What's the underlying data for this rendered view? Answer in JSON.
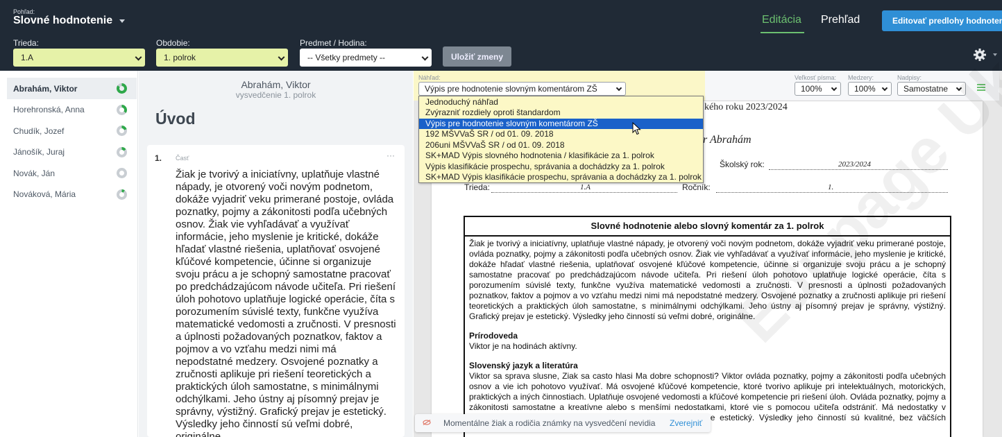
{
  "header": {
    "view_label": "Pohľad:",
    "view_title": "Slovné hodnotenie",
    "nav_edit": "Editácia",
    "nav_overview": "Prehľad",
    "edit_templates_button": "Editovať predlohy hodnotení",
    "accent_color": "#6cc070",
    "primary_color": "#2f8fd6"
  },
  "filters": {
    "class_label": "Trieda:",
    "class_value": "1.A",
    "period_label": "Obdobie:",
    "period_value": "1. polrok",
    "subject_label": "Predmet / Hodina:",
    "subject_value": "-- Všetky predmety --",
    "save_button": "Uložiť zmeny"
  },
  "students": [
    {
      "name": "Abrahám, Viktor",
      "active": true,
      "progress": 0.85
    },
    {
      "name": "Horehronská, Anna",
      "active": false,
      "progress": 0.35
    },
    {
      "name": "Chudík, Jozef",
      "active": false,
      "progress": 0.2
    },
    {
      "name": "Jánošík, Juraj",
      "active": false,
      "progress": 0.15
    },
    {
      "name": "Novák, Ján",
      "active": false,
      "progress": 0
    },
    {
      "name": "Nováková, Mária",
      "active": false,
      "progress": 0.1
    }
  ],
  "editor": {
    "student_name": "Abrahám, Viktor",
    "subtitle": "vysvedčenie 1. polrok",
    "section_title": "Úvod",
    "card_number": "1.",
    "card_part_label": "Časť",
    "card_menu": "···",
    "card_text": "Žiak je tvorivý a iniciatívny, uplatňuje vlastné nápady, je otvorený voči novým podnetom, dokáže vyjadriť veku primerané postoje, ovláda poznatky, pojmy a zákonitosti podľa učebných osnov. Žiak vie vyhľadávať a využívať informácie, jeho myslenie je kritické, dokáže hľadať vlastné riešenia, uplatňovať osvojené kľúčové kompetencie, účinne si organizuje svoju prácu a je schopný samostatne pracovať po predchádzajúcom návode učiteľa.  Pri riešení úloh pohotovo uplatňuje logické operácie, číta s porozumením súvislé texty, funkčne využíva matematické vedomosti a zručnosti. V presnosti a úplnosti požadovaných poznatkov, faktov a pojmov a vo vzťahu medzi nimi má nepodstatné medzery. Osvojené poznatky a zručnosti aplikuje pri riešení teoretických a praktických úloh samostatne, s minimálnymi odchýlkami. Jeho ústny aj písomný prejav je správny, výstižný. Grafický prejav je  estetický. Výsledky jeho činností sú veľmi dobré, originálne."
  },
  "preview_toolbar": {
    "view_label": "Náhľad:",
    "view_value": "Výpis pre hodnotenie slovným komentárom ZŠ",
    "font_size_label": "Veľkosť písma:",
    "font_size_value": "100%",
    "spacing_label": "Medzery:",
    "spacing_value": "100%",
    "captions_label": "Nadpisy:",
    "captions_value": "Samostatne"
  },
  "dropdown_options": [
    {
      "label": "Jednoduchý náhľad",
      "selected": false
    },
    {
      "label": "Zvýrazniť rozdiely oproti štandardom",
      "selected": false
    },
    {
      "label": "Výpis pre hodnotenie slovným komentárom ZŠ",
      "selected": true
    },
    {
      "label": "192 MŠVVaŠ SR / od 01. 09. 2018",
      "selected": false
    },
    {
      "label": "206uni MŠVVaŠ SR / od 01. 09. 2018",
      "selected": false
    },
    {
      "label": "SK+MAD Výpis slovného hodnotenia / klasifikácie za 1. polrok",
      "selected": false
    },
    {
      "label": "Výpis klasifikácie prospechu, správania a dochádzky za 1. polrok",
      "selected": false
    },
    {
      "label": "SK+MAD Výpis klasifikácie prospechu, správania a dochádzky za 1. polrok",
      "selected": false
    }
  ],
  "document": {
    "school_year_heading": "kého roku 2023/2024",
    "student_name_partial": "r Abrahám",
    "school_year_label": "Školský rok:",
    "school_year_value": "2023/2024",
    "class_label": "Trieda:",
    "class_value": "1.A",
    "grade_label": "Ročník:",
    "grade_value": "1.",
    "eval_title": "Slovné hodnotenie alebo slovný komentár za 1. polrok",
    "eval_intro": "Žiak je tvorivý a iniciatívny, uplatňuje vlastné nápady, je otvorený voči novým podnetom, dokáže vyjadriť veku primerané postoje, ovláda poznatky, pojmy a zákonitosti podľa učebných osnov. Žiak vie vyhľadávať a využívať informácie, jeho myslenie je kritické, dokáže hľadať vlastné riešenia, uplatňovať osvojené kľúčové kompetencie, účinne si organizuje svoju prácu a je schopný samostatne pracovať po predchádzajúcom návode učiteľa. Pri riešení úloh pohotovo uplatňuje logické operácie, číta s porozumením súvislé texty, funkčne využíva matematické vedomosti a zručnosti. V presnosti a úplnosti požadovaných poznatkov, faktov a pojmov a vo vzťahu medzi nimi má nepodstatné medzery. Osvojené poznatky a zručnosti aplikuje pri riešení teoretických a praktických úloh samostatne, s minimálnymi odchýlkami. Jeho ústny aj písomný prejav je správny, výstižný. Grafický prejav je estetický. Výsledky jeho činností sú veľmi dobré, originálne.",
    "subject1_title": "Prírodoveda",
    "subject1_text": "Viktor je na hodinách aktívny.",
    "subject2_title": "Slovenský jazyk a literatúra",
    "subject2_text": "Viktor sa sprava slusne, Ziak sa casto hlasi Ma dobre schopnosti? Viktor ovláda poznatky, pojmy a zákonitosti podľa učebných osnov a  vie ich pohotovo využívať. Má osvojené kľúčové kompetencie, ktoré tvorivo aplikuje pri intelektuálnych, motorických, praktických a iných činnostiach. Uplatňuje osvojené vedomosti a kľúčové kompetencie pri riešení úloh. Ovláda poznatky, pojmy a zákonitosti samostatne a kreatívne alebo s menšími nedostatkami, ktoré vie s pomocou učiteľa odstrániť. Má nedostatky v správnosti, presnosti a výstižnosti. Grafický prejav je prevažne estetický. Výsledky jeho činností sú kvalitné, bez väčších nedostatkov.",
    "watermark": "Edupage Ukážka"
  },
  "toast": {
    "text": "Momentálne žiak a rodičia známky na vysvedčení nevidia",
    "link": "Zverejniť"
  }
}
